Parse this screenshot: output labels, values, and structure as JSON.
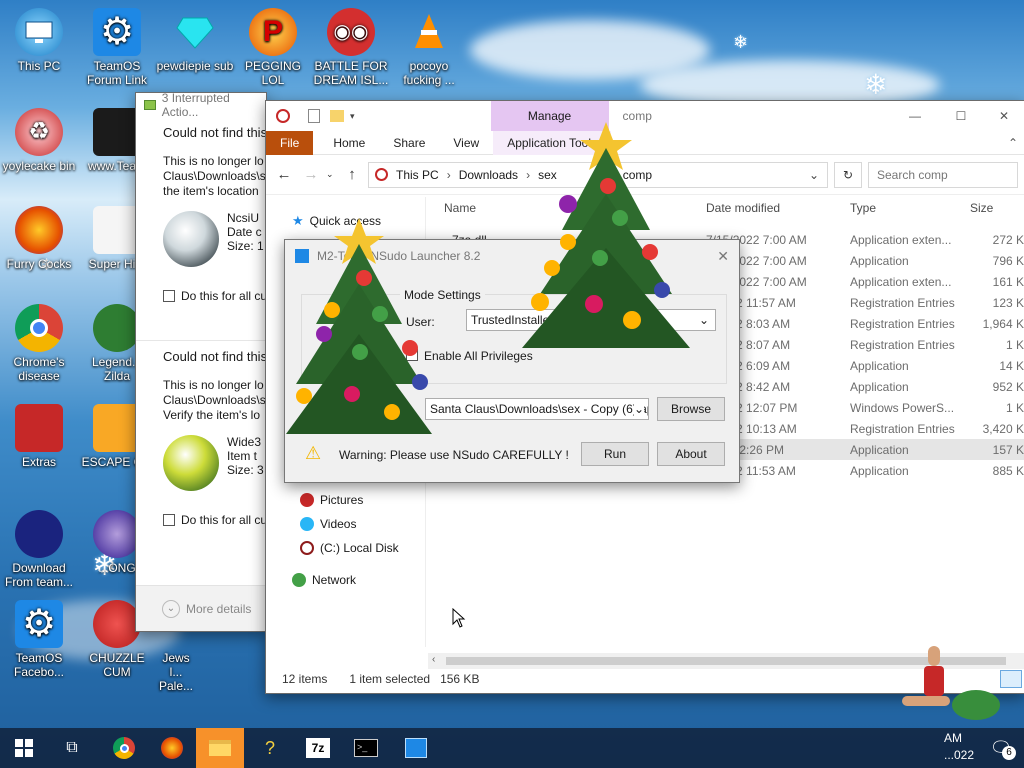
{
  "desktop": {
    "icons": [
      {
        "label": "This PC"
      },
      {
        "label": "TeamOS Forum Link"
      },
      {
        "label": "pewdiepie sub"
      },
      {
        "label": "PEGGING LOL"
      },
      {
        "label": "BATTLE FOR DREAM ISL..."
      },
      {
        "label": "pocoyo fucking ..."
      },
      {
        "label": "yoylecake bin"
      },
      {
        "label": "www.Tea..."
      },
      {
        "label": "Furry Cocks"
      },
      {
        "label": "Super Hi..."
      },
      {
        "label": "Chrome's disease"
      },
      {
        "label": "Legend... Zilda"
      },
      {
        "label": "Extras"
      },
      {
        "label": "ESCAPE C..."
      },
      {
        "label": "Download From team..."
      },
      {
        "label": "...ONG"
      },
      {
        "label": "TeamOS Facebo..."
      },
      {
        "label": "CHUZZLE CUM"
      },
      {
        "label": "Jews l... Pale..."
      }
    ]
  },
  "interrupted": {
    "title": "3 Interrupted Actio...",
    "sections": [
      {
        "heading": "Could not find this",
        "desc1": "This is no longer lo",
        "desc2": "Claus\\Downloads\\s",
        "desc3": "the item's location",
        "file_name": "NcsiU",
        "file_date": "Date c",
        "file_size": "Size: 1",
        "checkbox": "Do this for all cu"
      },
      {
        "heading": "Could not find this",
        "desc1": "This is no longer lo",
        "desc2": "Claus\\Downloads\\s",
        "desc3": "Verify the item's lo",
        "file_name": "Wide3",
        "file_date": "Item t",
        "file_size": "Size: 3",
        "checkbox": "Do this for all cu"
      }
    ],
    "more_details": "More details"
  },
  "explorer": {
    "window_title": "comp",
    "manage_tab": "Manage",
    "ribbon_tabs": [
      "File",
      "Home",
      "Share",
      "View",
      "Application Tools"
    ],
    "breadcrumb": [
      "This PC",
      "Downloads",
      "sex",
      "comp"
    ],
    "search_placeholder": "Search comp",
    "nav": {
      "quick_access": "Quick access",
      "pictures": "Pictures",
      "videos": "Videos",
      "local_disk": "(C:) Local Disk",
      "network": "Network"
    },
    "columns": {
      "name": "Name",
      "date": "Date modified",
      "type": "Type",
      "size": "Size"
    },
    "rows": [
      {
        "name": "7za.dll",
        "date": "7/15/2022 7:00 AM",
        "type": "Application exten...",
        "size": "272 K"
      },
      {
        "name": "",
        "date": "7/15/2022 7:00 AM",
        "type": "Application",
        "size": "796 K"
      },
      {
        "name": "",
        "date": "7/15/2022 7:00 AM",
        "type": "Application exten...",
        "size": "161 K"
      },
      {
        "name": "",
        "date": "...2022 11:57 AM",
        "type": "Registration Entries",
        "size": "123 K"
      },
      {
        "name": "",
        "date": "...2022 8:03 AM",
        "type": "Registration Entries",
        "size": "1,964 K"
      },
      {
        "name": "",
        "date": "...2022 8:07 AM",
        "type": "Registration Entries",
        "size": "1 K"
      },
      {
        "name": "",
        "date": "...2022 6:09 AM",
        "type": "Application",
        "size": "14 K"
      },
      {
        "name": "",
        "date": "...2022 8:42 AM",
        "type": "Application",
        "size": "952 K"
      },
      {
        "name": "",
        "date": "...2022 12:07 PM",
        "type": "Windows PowerS...",
        "size": "1 K"
      },
      {
        "name": "",
        "date": "...2022 10:13 AM",
        "type": "Registration Entries",
        "size": "3,420 K"
      },
      {
        "name": "",
        "date": "...21 12:26 PM",
        "type": "Application",
        "size": "157 K"
      },
      {
        "name": "",
        "date": "...2022 11:53 AM",
        "type": "Application",
        "size": "885 K"
      }
    ],
    "status": {
      "items": "12 items",
      "selected": "1 item selected",
      "size": "156 KB"
    }
  },
  "nsudo": {
    "title": "M2-Team NSudo Launcher 8.2",
    "group_label": "Mode Settings",
    "user_label": "User:",
    "user_value": "TrustedInstaller",
    "enable_all": "Enable All Privileges",
    "path_value": "Santa Claus\\Downloads\\sex - Copy (6)\\ap",
    "browse": "Browse",
    "warning": "Warning: Please use NSudo CAREFULLY !",
    "run": "Run",
    "about": "About"
  },
  "taskbar": {
    "clock_line1": "AM",
    "clock_line2": "...022",
    "notification_count": "6"
  },
  "colors": {
    "manage_tab": "#e5c6f2",
    "file_tab": "#b94f0c",
    "taskbar": "#102038",
    "selection": "#e5e5e5"
  }
}
